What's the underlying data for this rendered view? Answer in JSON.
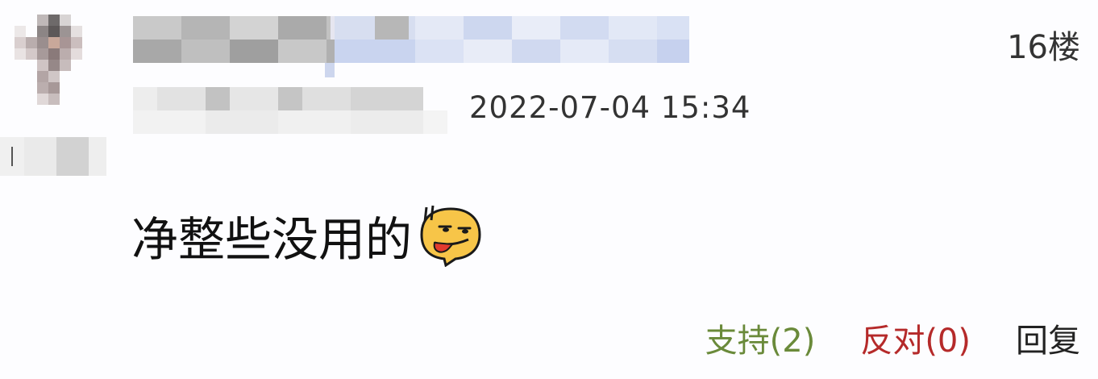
{
  "post": {
    "floor": "16楼",
    "timestamp": "2022-07-04 15:34",
    "content": "净整些没用的"
  },
  "actions": {
    "support": "支持(2)",
    "oppose": "反对(0)",
    "reply": "回复"
  },
  "colors": {
    "support": "#6a8a3a",
    "oppose": "#b52a2a",
    "background": "#fdfdff"
  },
  "icons": {
    "emoji": "smirk-face-emoji"
  }
}
